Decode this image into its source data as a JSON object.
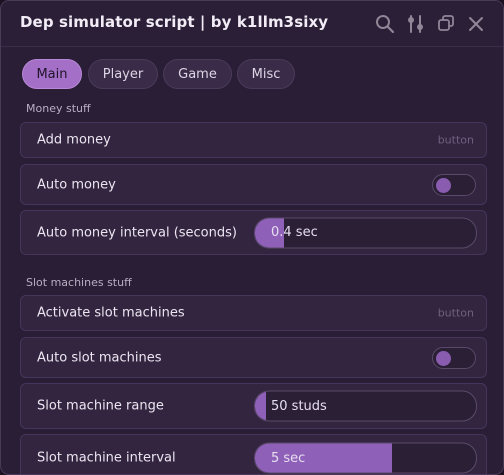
{
  "window": {
    "title": "Dep simulator script | by k1llm3sixy"
  },
  "titlebar_icons": [
    "search-icon",
    "sliders-icon",
    "restore-icon",
    "close-icon"
  ],
  "colors": {
    "accent": "#a36fc7",
    "slider_fill": "#8f60b8",
    "panel_bg": "#2a1d36",
    "row_bg": "#33253f"
  },
  "tabs": [
    {
      "label": "Main",
      "active": true
    },
    {
      "label": "Player",
      "active": false
    },
    {
      "label": "Game",
      "active": false
    },
    {
      "label": "Misc",
      "active": false
    }
  ],
  "sections": {
    "money": {
      "label": "Money stuff",
      "add_money": {
        "label": "Add money",
        "hint": "button"
      },
      "auto_money": {
        "label": "Auto money",
        "enabled": false
      },
      "auto_money_interval": {
        "label": "Auto money interval (seconds)",
        "value_text": "0.4 sec",
        "fill_fraction": 0.13
      }
    },
    "slots": {
      "label": "Slot machines stuff",
      "activate": {
        "label": "Activate slot machines",
        "hint": "button"
      },
      "auto": {
        "label": "Auto slot machines",
        "enabled": false
      },
      "range": {
        "label": "Slot machine range",
        "value_text": "50 studs",
        "fill_fraction": 0.05
      },
      "interval": {
        "label": "Slot machine interval",
        "value_text": "5 sec",
        "fill_fraction": 0.62
      }
    }
  }
}
